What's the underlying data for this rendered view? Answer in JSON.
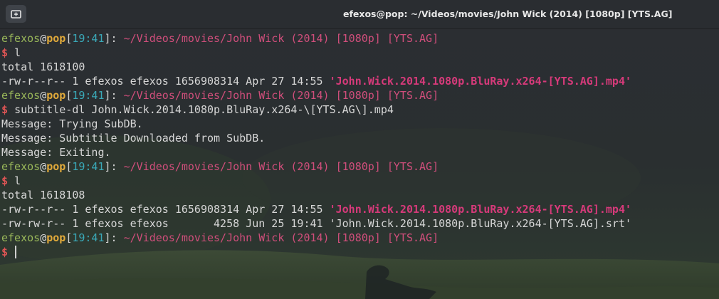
{
  "window": {
    "title": "efexos@pop: ~/Videos/movies/John Wick (2014) [1080p] [YTS.AG]",
    "new_tab_icon": "new-tab-icon"
  },
  "prompt": {
    "user": "efexos",
    "at": "@",
    "host": "pop",
    "open_bracket": "[",
    "time": "19:41",
    "close_bracket": "]",
    "colon": ": ",
    "cwd": "~/Videos/movies/John Wick (2014) [1080p] [YTS.AG]",
    "dollar": "$ "
  },
  "terminal": {
    "cmd1": "l",
    "total1": "total 1618100",
    "ls1_meta": "-rw-r--r-- 1 efexos efexos 1656908314 Apr 27 14:55 ",
    "ls1_name": "'John.Wick.2014.1080p.BluRay.x264-[YTS.AG].mp4'",
    "cmd2": "subtitle-dl John.Wick.2014.1080p.BluRay.x264-\\[YTS.AG\\].mp4",
    "msg1": "Message: Trying SubDB.",
    "msg2": "Message: Subtitile Downloaded from SubDB.",
    "msg3": "Message: Exiting.",
    "cmd3": "l",
    "total2": "total 1618108",
    "ls2_meta": "-rw-r--r-- 1 efexos efexos 1656908314 Apr 27 14:55 ",
    "ls2_name": "'John.Wick.2014.1080p.BluRay.x264-[YTS.AG].mp4'",
    "ls3_meta": "-rw-rw-r-- 1 efexos efexos       4258 Jun 25 19:41 ",
    "ls3_name": "'John.Wick.2014.1080p.BluRay.x264-[YTS.AG].srt'"
  },
  "colors": {
    "user": "#9ab85a",
    "host": "#e0a93a",
    "time": "#3aa9b8",
    "cwd": "#d04e7b",
    "dollar": "#e05555",
    "highlight_file": "#d63a7a"
  }
}
